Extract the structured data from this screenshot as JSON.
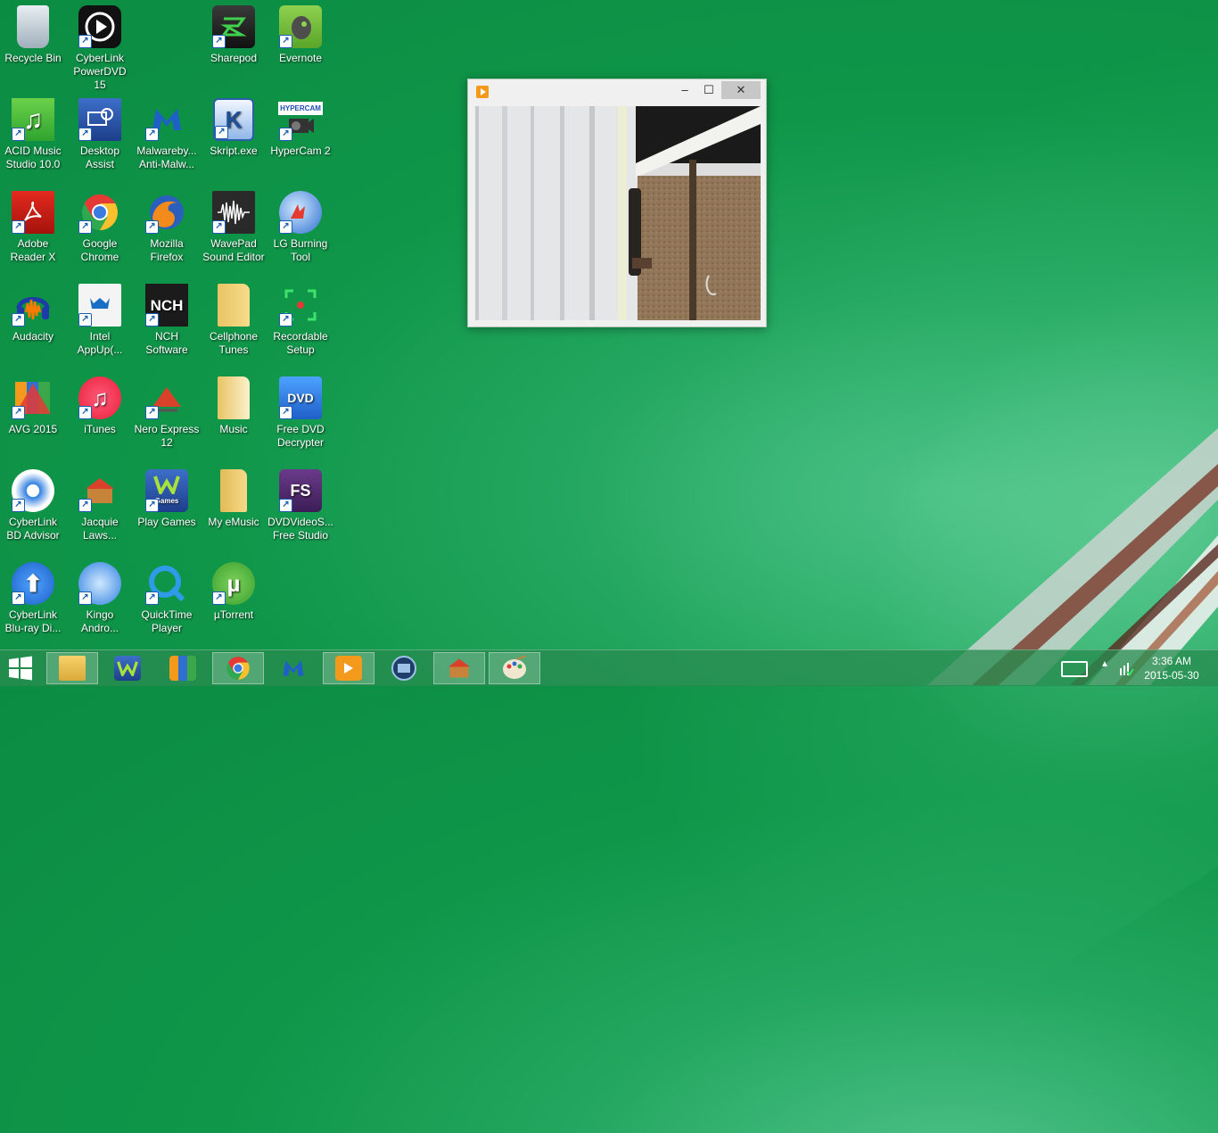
{
  "desktop": {
    "icons": [
      {
        "label": "Recycle Bin"
      },
      {
        "label": "CyberLink PowerDVD 15"
      },
      {
        "label": "Sharepod"
      },
      {
        "label": "Evernote"
      },
      {
        "label": "ACID Music Studio 10.0"
      },
      {
        "label": "Desktop Assist"
      },
      {
        "label": "Malwareby... Anti-Malw..."
      },
      {
        "label": "Skript.exe"
      },
      {
        "label": "HyperCam 2"
      },
      {
        "label": "Adobe Reader X"
      },
      {
        "label": "Google Chrome"
      },
      {
        "label": "Mozilla Firefox"
      },
      {
        "label": "WavePad Sound Editor"
      },
      {
        "label": "LG Burning Tool"
      },
      {
        "label": "Audacity"
      },
      {
        "label": "Intel AppUp(..."
      },
      {
        "label": "NCH Software"
      },
      {
        "label": "Cellphone Tunes"
      },
      {
        "label": "Recordable Setup"
      },
      {
        "label": "AVG 2015"
      },
      {
        "label": "iTunes"
      },
      {
        "label": "Nero Express 12"
      },
      {
        "label": "Music"
      },
      {
        "label": "Free DVD Decrypter"
      },
      {
        "label": "CyberLink BD Advisor"
      },
      {
        "label": "Jacquie Laws..."
      },
      {
        "label": "Play Games"
      },
      {
        "label": "My eMusic"
      },
      {
        "label": "DVDVideoS... Free Studio"
      },
      {
        "label": "CyberLink Blu-ray Di..."
      },
      {
        "label": "Kingo Andro..."
      },
      {
        "label": "QuickTime Player"
      },
      {
        "label": "µTorrent"
      }
    ],
    "glyph_text": {
      "skript": "K",
      "nch": "NCH",
      "dvd": "DVD",
      "fs": "FS",
      "hypercam": "HYPERCAM",
      "play_games": "Games"
    }
  },
  "window": {
    "minimize": "–",
    "maximize": "☐",
    "close": "✕"
  },
  "taskbar": {
    "clock_time": "3:36 AM",
    "clock_date": "2015-05-30",
    "apps": [
      "start",
      "file-explorer",
      "play-games",
      "avg",
      "chrome",
      "malwarebytes",
      "player",
      "video",
      "jacquie",
      "paint"
    ]
  },
  "colors": {
    "accent": "#0f9649",
    "taskbar": "#288c50"
  }
}
